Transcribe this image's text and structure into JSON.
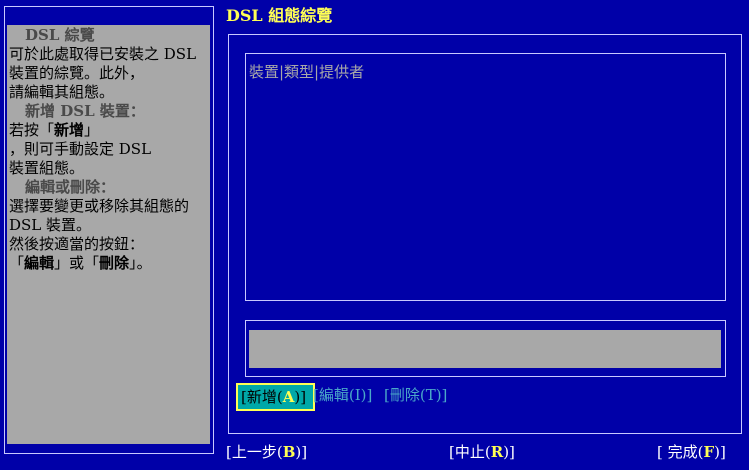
{
  "title": "DSL 組態綜覽",
  "help": {
    "heading1": "DSL 綜覽",
    "line1": "可於此處取得已安裝之 DSL",
    "line2": "裝置的綜覽。此外，",
    "line3": "請編輯其組態。",
    "heading2": "新增 DSL 裝置：",
    "line4a": "若按「",
    "line4b": "新增",
    "line4c": "」",
    "line5": "，則可手動設定 DSL",
    "line6": "裝置組態。",
    "heading3": "編輯或刪除：",
    "line7": "選擇要變更或移除其組態的",
    "line8": "DSL 裝置。",
    "line9": "然後按適當的按鈕：",
    "line10a": "「",
    "line10b": "編輯",
    "line10c": "」或「",
    "line10d": "刪除",
    "line10e": "」。"
  },
  "table": {
    "headers": [
      "裝置",
      "類型",
      "提供者"
    ],
    "header_text": "裝置|類型|提供者"
  },
  "buttons": {
    "add_pre": "[新增(",
    "add_hot": "A",
    "add_post": ")]",
    "edit": "[編輯(I)]",
    "delete": "[刪除(T)]"
  },
  "nav": {
    "back_pre": "[上一步(",
    "back_hot": "B",
    "back_post": ")]",
    "abort_pre": "[中止(",
    "abort_hot": "R",
    "abort_post": ")]",
    "finish_pre": "[ 完成(",
    "finish_hot": "F",
    "finish_post": ")]"
  },
  "colors": {
    "background": "#0000a8",
    "panel": "#a8a8a8",
    "title": "#ffff54",
    "focus_button": "#00a8a8"
  }
}
